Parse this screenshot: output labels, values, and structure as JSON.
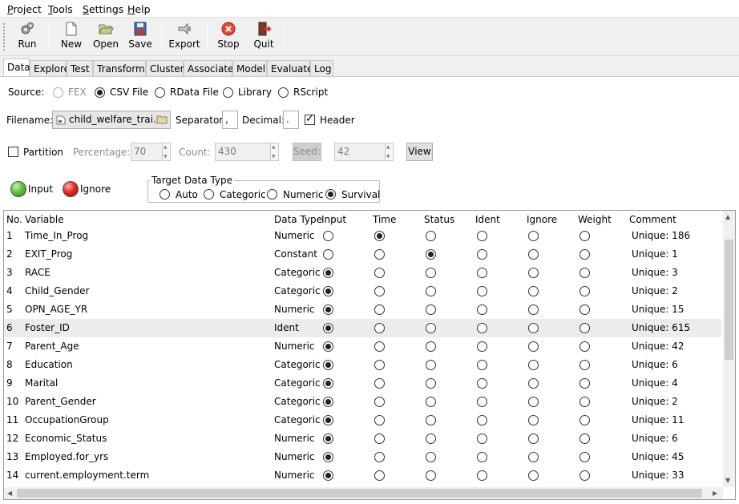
{
  "menu": [
    {
      "ul": "P",
      "rest": "roject"
    },
    {
      "ul": "T",
      "rest": "ools"
    },
    {
      "ul": "S",
      "rest": "ettings"
    },
    {
      "ul": "H",
      "rest": "elp"
    }
  ],
  "toolbar": {
    "run": "Run",
    "new": "New",
    "open": "Open",
    "save": "Save",
    "export": "Export",
    "stop": "Stop",
    "quit": "Quit"
  },
  "tabs": [
    "Data",
    "Explore",
    "Test",
    "Transform",
    "Cluster",
    "Associate",
    "Model",
    "Evaluate",
    "Log"
  ],
  "source": {
    "label": "Source:",
    "options": [
      "FEX",
      "CSV File",
      "RData File",
      "Library",
      "RScript"
    ],
    "selected": "CSV File"
  },
  "file": {
    "filename_label": "Filename:",
    "filename": "child_welfare_trai...",
    "separator_label": "Separator:",
    "separator": ",",
    "decimal_label": "Decimal:",
    "decimal": ".",
    "header_label": "Header",
    "header_checked": true
  },
  "partition": {
    "label": "Partition",
    "checked": false,
    "percentage_label": "Percentage:",
    "percentage": "70",
    "count_label": "Count:",
    "count": "430",
    "seed_label": "Seed:",
    "seed": "42",
    "view_label": "View"
  },
  "legend": {
    "input": "Input",
    "ignore": "Ignore"
  },
  "target": {
    "title": "Target Data Type",
    "options": [
      "Auto",
      "Categoric",
      "Numeric",
      "Survival"
    ],
    "selected": "Survival"
  },
  "table": {
    "headers": {
      "no": "No.",
      "variable": "Variable",
      "data_type": "Data Type",
      "input": "Input",
      "time": "Time",
      "status": "Status",
      "ident": "Ident",
      "ignore": "Ignore",
      "weight": "Weight",
      "comment": "Comment"
    },
    "rows": [
      {
        "no": "1",
        "variable": "Time_In_Prog",
        "type": "Numeric",
        "role": "time",
        "comment": "Unique: 186"
      },
      {
        "no": "2",
        "variable": "EXIT_Prog",
        "type": "Constant",
        "role": "status",
        "comment": "Unique: 1"
      },
      {
        "no": "3",
        "variable": "RACE",
        "type": "Categoric",
        "role": "input",
        "comment": "Unique: 3"
      },
      {
        "no": "4",
        "variable": "Child_Gender",
        "type": "Categoric",
        "role": "input",
        "comment": "Unique: 2"
      },
      {
        "no": "5",
        "variable": "OPN_AGE_YR",
        "type": "Numeric",
        "role": "input",
        "comment": "Unique: 15"
      },
      {
        "no": "6",
        "variable": "Foster_ID",
        "type": "Ident",
        "role": "input",
        "comment": "Unique: 615"
      },
      {
        "no": "7",
        "variable": "Parent_Age",
        "type": "Numeric",
        "role": "input",
        "comment": "Unique: 42"
      },
      {
        "no": "8",
        "variable": "Education",
        "type": "Categoric",
        "role": "input",
        "comment": "Unique: 6"
      },
      {
        "no": "9",
        "variable": "Marital",
        "type": "Categoric",
        "role": "input",
        "comment": "Unique: 4"
      },
      {
        "no": "10",
        "variable": "Parent_Gender",
        "type": "Categoric",
        "role": "input",
        "comment": "Unique: 2"
      },
      {
        "no": "11",
        "variable": "OccupationGroup",
        "type": "Categoric",
        "role": "input",
        "comment": "Unique: 11"
      },
      {
        "no": "12",
        "variable": "Economic_Status",
        "type": "Numeric",
        "role": "input",
        "comment": "Unique: 6"
      },
      {
        "no": "13",
        "variable": "Employed.for_yrs",
        "type": "Numeric",
        "role": "input",
        "comment": "Unique: 45"
      },
      {
        "no": "14",
        "variable": "current.employment.term",
        "type": "Numeric",
        "role": "input",
        "comment": "Unique: 33"
      }
    ]
  }
}
